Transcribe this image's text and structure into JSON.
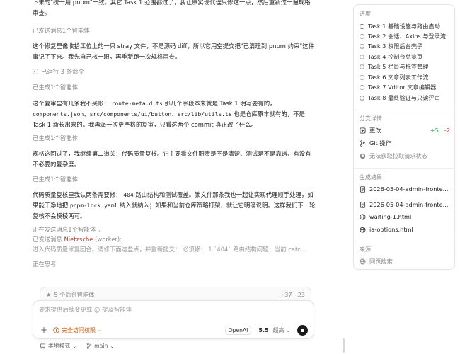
{
  "chat": {
    "para1": "卜来的\"统一用 pnpm\"一致。其它 Task 1 范围都过了，我让原实现代理只修这一点，然后重新过一遍规格审查。",
    "meta_sent_1": "已发送消息1个智能体",
    "para2": "这个修复里像收拾工位上的一只 stray 文件，不是源码 diff，所以它用空提交把\"已清理到 pnpm 约束\"这件事记了下来。我先自己核一眼，再重新跑一次规格审查。",
    "meta_ran": "已运行 3 条命令",
    "meta_gen_1": "已生成1个智能体",
    "para3_a": "这个复审里有几条我不买账：",
    "para3_code1": "route-meta.d.ts",
    "para3_b": "那几个字段本来就是 Task 1 明写要有的，",
    "para3_code2": "components.json",
    "para3_sep1": "、",
    "para3_code3": "src/components/ui/button",
    "para3_sep2": "、",
    "para3_code4": "src/lib/utils.ts",
    "para3_c": "也是仓库原本就有的，不是 Task 1 新长出来的。我再派一次更严格的复审，只看这两个 commit 真正改了什么。",
    "meta_gen_2": "已生成1个智能体",
    "para4": "规格这回过了，我继续第二道关：代码质量复核。它主要看文件职责是不是清楚、测试是不是靠谱、有没有不必要的复杂度。",
    "meta_gen_3": "已生成1个智能体",
    "para5_a": "代码质量复核里我认两条需要修：",
    "para5_code1": "404",
    "para5_b": "路由结构和测试覆盖。锁文件那条我也一起让实现代理顺手处理，如果能干净地把",
    "para5_code2": "pnpm-lock.yaml",
    "para5_c": "纳入就纳入；如果和当前仓库策略打架，就让它明确说明。这样我们下一轮复核不会模棱两可。",
    "meta_sending": "正在发送消息1个智能体",
    "meta_sent_2_prefix": "已发送消息",
    "agent_name": "Nietzsche",
    "agent_role": "(worker):",
    "meta_preview": "进入代码质量修复回合。请修下面这些点，并重新提交： 必须修： 1.`404` 路由结构问题：当前 catc...",
    "meta_thinking": "正在思考"
  },
  "composer": {
    "agents_label": "5 个后台智能体",
    "diff_add": "+37",
    "diff_del": "-23",
    "placeholder": "要求提供后续变更或 @ 提及智能体",
    "permission": "完全访问权限",
    "provider": "OpenAI",
    "version": "5.5",
    "effort": "超高"
  },
  "footer": {
    "mode": "本地模式",
    "branch": "main"
  },
  "panel": {
    "progress_title": "进度",
    "tasks": [
      "Task 1 基础设施与路由启动",
      "Task 2 会话、Axios 与登录流",
      "Task 3 权限后台壳子",
      "Task 4 控制台总览页",
      "Task 5 栏目与标签管理",
      "Task 6 文章列表工作流",
      "Task 7 Vditor 文章编辑器",
      "Task 8 最终验证与只读评审"
    ],
    "branch_title": "分支详情",
    "changes_label": "更改",
    "changes_add": "+5",
    "changes_del": "-2",
    "git_label": "Git 操作",
    "pr_label": "无法获取拉取请求状态",
    "results_title": "生成结果",
    "results": [
      "2026-05-04-admin-fronte...",
      "2026-05-04-admin-fronte...",
      "waiting-1.html",
      "ia-options.html"
    ],
    "source_title": "来源",
    "source_label": "网页搜索"
  },
  "colors": {
    "accent_add": "#27ae60",
    "accent_del": "#c0392b",
    "permission": "#d35400"
  }
}
